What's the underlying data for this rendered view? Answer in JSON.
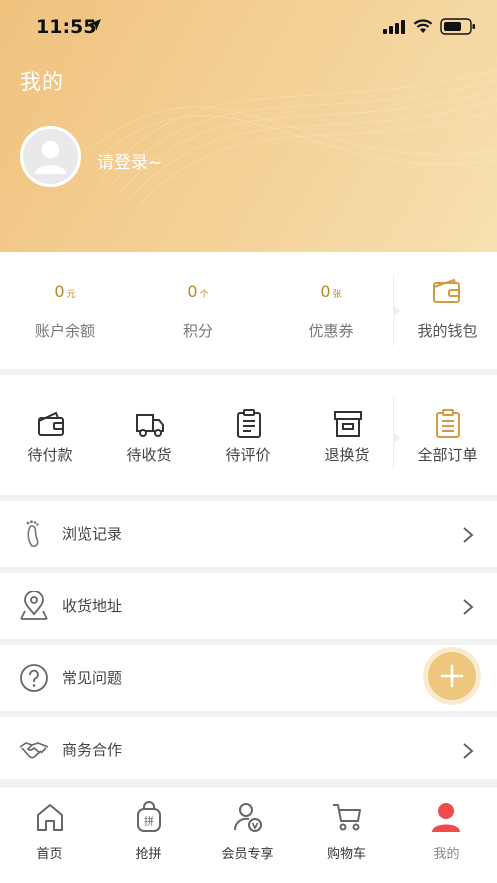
{
  "status_bar": {
    "time": "11:55"
  },
  "header": {
    "title": "我的",
    "login_prompt": "请登录~"
  },
  "account": {
    "stats": [
      {
        "value": "0",
        "unit": "元",
        "label": "账户余额"
      },
      {
        "value": "0",
        "unit": "个",
        "label": "积分"
      },
      {
        "value": "0",
        "unit": "张",
        "label": "优惠券"
      }
    ],
    "wallet_label": "我的钱包"
  },
  "orders": {
    "items": [
      {
        "label": "待付款",
        "icon": "wallet-icon"
      },
      {
        "label": "待收货",
        "icon": "truck-icon"
      },
      {
        "label": "待评价",
        "icon": "clipboard-icon"
      },
      {
        "label": "退换货",
        "icon": "box-icon"
      }
    ],
    "all_label": "全部订单"
  },
  "menu": [
    {
      "label": "浏览记录",
      "icon": "footprint-icon"
    },
    {
      "label": "收货地址",
      "icon": "location-pin-icon"
    },
    {
      "label": "常见问题",
      "icon": "question-icon"
    },
    {
      "label": "商务合作",
      "icon": "handshake-icon"
    }
  ],
  "tabbar": {
    "items": [
      {
        "label": "首页",
        "icon": "home-icon"
      },
      {
        "label": "抢拼",
        "icon": "shopping-bag-icon",
        "badge_text": "拼"
      },
      {
        "label": "会员专享",
        "icon": "member-icon"
      },
      {
        "label": "购物车",
        "icon": "cart-icon"
      },
      {
        "label": "我的",
        "icon": "user-icon",
        "active": true
      }
    ]
  },
  "colors": {
    "accent": "#b8862b",
    "header_gradient_start": "#f0c27e",
    "header_gradient_end": "#f7e0b0",
    "active_tab": "#f04b4b",
    "fab": "#efc77c"
  }
}
